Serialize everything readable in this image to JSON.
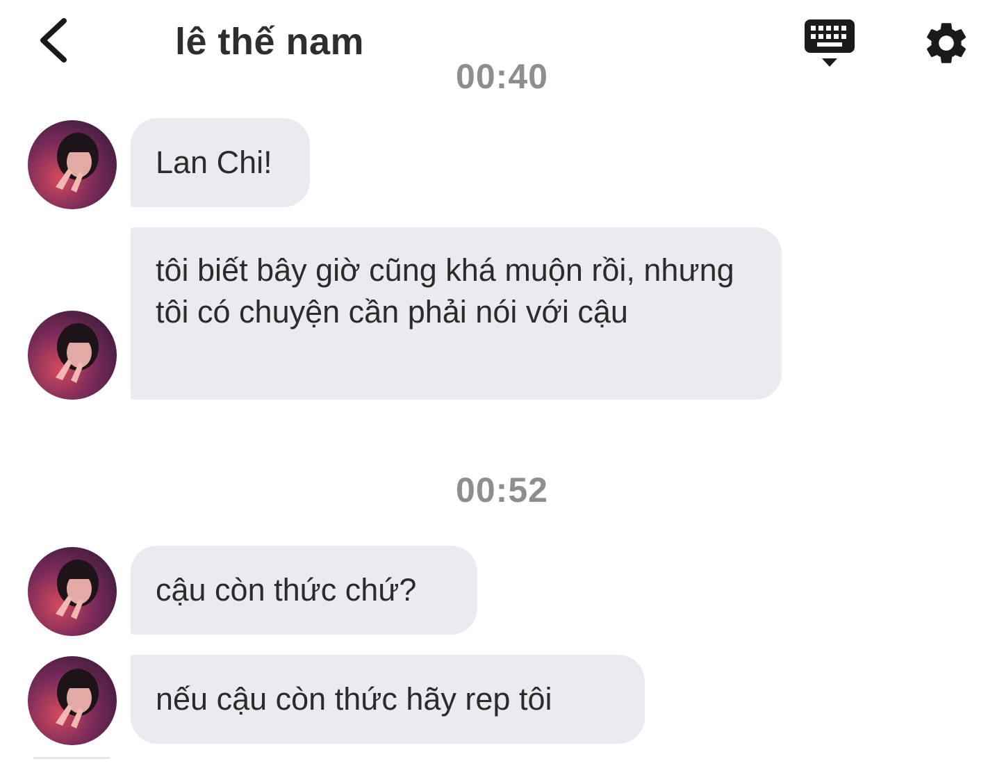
{
  "header": {
    "title": "lê thế nam",
    "back_icon": "chevron-left-icon",
    "keyboard_icon": "keyboard-icon",
    "settings_icon": "gear-icon"
  },
  "conversation": {
    "timestamps": [
      "00:40",
      "00:52"
    ],
    "messages": [
      {
        "text": "Lan Chi!"
      },
      {
        "text": "tôi biết bây giờ cũng khá muộn rồi, nhưng tôi có chuyện cần phải nói với cậu"
      },
      {
        "text": "cậu còn thức chứ?"
      },
      {
        "text": "nếu cậu còn thức hãy rep tôi"
      }
    ]
  },
  "colors": {
    "bubble_bg": "#e9ebf0",
    "timestamp": "#8e8e8e",
    "text": "#2b2b2b",
    "icon": "#1a1a1a"
  }
}
